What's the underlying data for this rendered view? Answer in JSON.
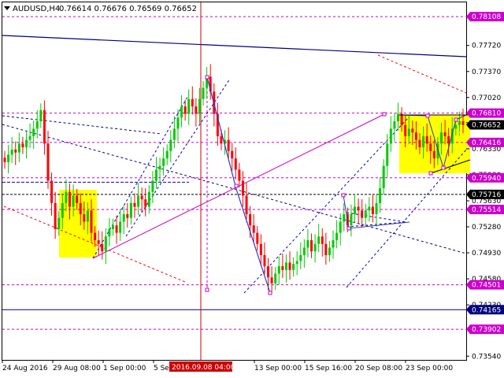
{
  "header": {
    "symbol": "AUDUSD,H4",
    "ohlc": "0.76614 0.76676 0.76569 0.76652"
  },
  "colors": {
    "bull": "#00cc00",
    "bear": "#ff0000",
    "level": "#cc00cc",
    "trendline": "#000080",
    "wave": "#3333cc",
    "channel": "#0000cc",
    "box": "#ffff00",
    "marker": "#cc0000"
  },
  "chart_data": {
    "type": "candlestick",
    "title": "AUDUSD,H4",
    "ylim": [
      0.7349,
      0.783
    ],
    "y_ticks": [
      "0.78108",
      "0.77720",
      "0.77370",
      "0.77020",
      "0.76681",
      "0.76330",
      "0.75980",
      "0.75630",
      "0.75280",
      "0.74930",
      "0.74580",
      "0.74230",
      "0.73540"
    ],
    "x_ticks": [
      "24 Aug 2016",
      "29 Aug 08:00",
      "1 Sep 00:00",
      "5 Sep 16:00",
      "13 Sep 00:00",
      "15 Sep 16:00",
      "20 Sep 08:00",
      "23 Sep 00:00"
    ],
    "highlight_time": "2016.09.08 04:00",
    "price_tags": [
      {
        "label": "0.78108",
        "kind": "level"
      },
      {
        "label": "0.76810",
        "kind": "level"
      },
      {
        "label": "0.76652",
        "kind": "current"
      },
      {
        "label": "0.76416",
        "kind": "level"
      },
      {
        "label": "0.75940",
        "kind": "level"
      },
      {
        "label": "0.75716",
        "kind": "bid"
      },
      {
        "label": "0.75514",
        "kind": "level"
      },
      {
        "label": "0.74501",
        "kind": "level"
      },
      {
        "label": "0.74165",
        "kind": "support"
      },
      {
        "label": "0.73902",
        "kind": "level"
      }
    ],
    "levels": [
      0.78108,
      0.7681,
      0.76416,
      0.7594,
      0.75716,
      0.75514,
      0.74501,
      0.74165,
      0.73902
    ],
    "closes": [
      0.7615,
      0.7625,
      0.7632,
      0.7628,
      0.764,
      0.7635,
      0.7645,
      0.765,
      0.766,
      0.767,
      0.7685,
      0.764,
      0.759,
      0.756,
      0.7525,
      0.754,
      0.756,
      0.7575,
      0.7555,
      0.757,
      0.756,
      0.7545,
      0.7535,
      0.755,
      0.752,
      0.751,
      0.7505,
      0.7495,
      0.7515,
      0.7525,
      0.753,
      0.752,
      0.7535,
      0.7545,
      0.754,
      0.756,
      0.7555,
      0.757,
      0.7565,
      0.7555,
      0.7575,
      0.759,
      0.7605,
      0.761,
      0.762,
      0.763,
      0.7645,
      0.766,
      0.7675,
      0.769,
      0.768,
      0.77,
      0.769,
      0.768,
      0.77,
      0.7715,
      0.773,
      0.771,
      0.768,
      0.765,
      0.764,
      0.7645,
      0.763,
      0.762,
      0.7605,
      0.759,
      0.757,
      0.7545,
      0.753,
      0.752,
      0.7505,
      0.749,
      0.7475,
      0.746,
      0.7452,
      0.7465,
      0.7475,
      0.747,
      0.748,
      0.747,
      0.7478,
      0.7482,
      0.749,
      0.75,
      0.751,
      0.7495,
      0.7505,
      0.7515,
      0.7505,
      0.749,
      0.75,
      0.751,
      0.752,
      0.7535,
      0.7545,
      0.753,
      0.7545,
      0.7555,
      0.755,
      0.754,
      0.755,
      0.7555,
      0.7545,
      0.756,
      0.758,
      0.761,
      0.764,
      0.766,
      0.767,
      0.768,
      0.7665,
      0.765,
      0.766,
      0.7655,
      0.7645,
      0.7635,
      0.765,
      0.764,
      0.763,
      0.762,
      0.764,
      0.7655,
      0.765,
      0.764,
      0.766,
      0.7665,
      0.767,
      0.7665
    ]
  }
}
